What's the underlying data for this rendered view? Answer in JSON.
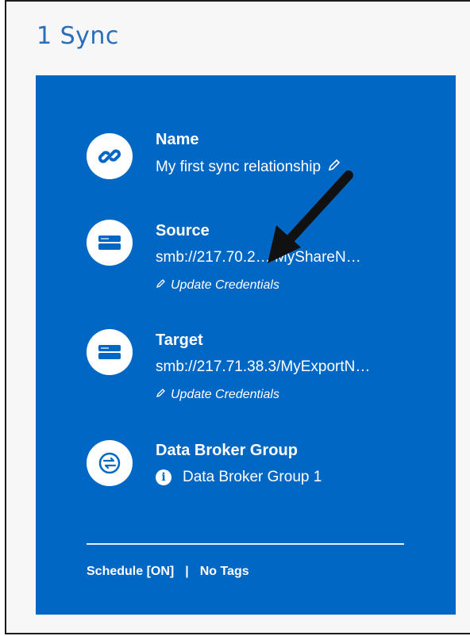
{
  "header": {
    "title": "1 Sync"
  },
  "name": {
    "label": "Name",
    "value": "My first sync relationship"
  },
  "source": {
    "label": "Source",
    "value": "smb://217.70.2…/MyShareN…",
    "credentials": "Update Credentials"
  },
  "target": {
    "label": "Target",
    "value": "smb://217.71.38.3/MyExportN…",
    "credentials": "Update Credentials"
  },
  "broker": {
    "label": "Data Broker Group",
    "value": "Data Broker Group 1"
  },
  "footer": {
    "schedule": "Schedule [ON]",
    "separator": "|",
    "tags": "No Tags"
  },
  "icons": [
    "link-icon",
    "storage-icon",
    "storage-icon",
    "sync-arrows-icon",
    "info-icon",
    "pencil-icon",
    "arrow-annotation-icon"
  ],
  "colors": {
    "card": "#0067c5",
    "title": "#2a6ebb",
    "background": "#f7f7f7"
  }
}
